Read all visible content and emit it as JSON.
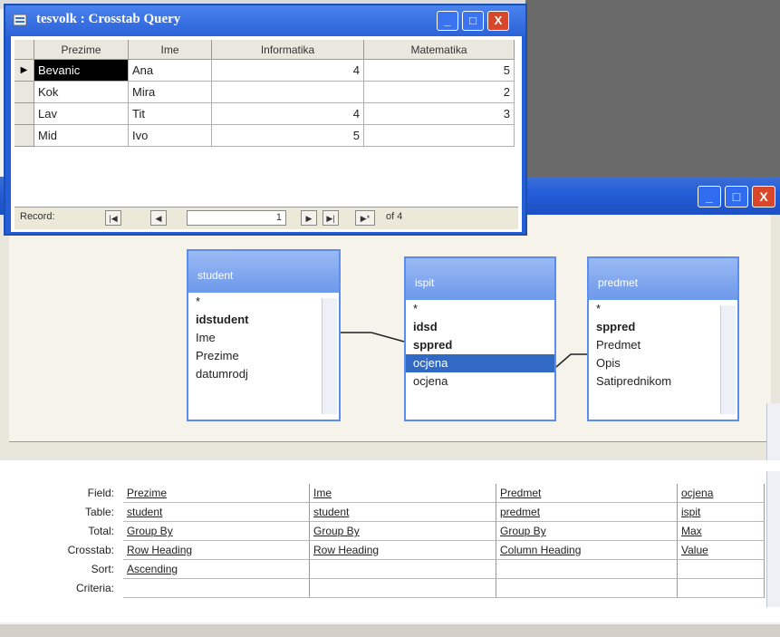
{
  "crosstab_window": {
    "title": "tesvolk : Crosstab Query",
    "icon": "query-icon",
    "controls": {
      "minimize": "_",
      "maximize": "□",
      "close": "X"
    },
    "columns": [
      "Prezime",
      "Ime",
      "Informatika",
      "Matematika"
    ],
    "rows": [
      {
        "selector": "▶",
        "prezime": "Bevanic",
        "ime": "Ana",
        "informatika": "4",
        "matematika": "5"
      },
      {
        "selector": "",
        "prezime": "Kok",
        "ime": "Mira",
        "informatika": "",
        "matematika": "2"
      },
      {
        "selector": "",
        "prezime": "Lav",
        "ime": "Tit",
        "informatika": "4",
        "matematika": "3"
      },
      {
        "selector": "",
        "prezime": "Mid",
        "ime": "Ivo",
        "informatika": "5",
        "matematika": ""
      }
    ],
    "navigation": {
      "label": "Record:",
      "first": "|◀",
      "prev": "◀",
      "current": "1",
      "next": "▶",
      "last": "▶|",
      "new": "▶*",
      "of": "of 4"
    }
  },
  "design_window": {
    "controls": {
      "minimize": "_",
      "maximize": "□",
      "close": "X"
    },
    "field_lists": [
      {
        "name": "student",
        "fields": [
          {
            "label": "*",
            "key": false,
            "selected": false
          },
          {
            "label": "idstudent",
            "key": true,
            "selected": false
          },
          {
            "label": "Ime",
            "key": false,
            "selected": false
          },
          {
            "label": "Prezime",
            "key": false,
            "selected": false
          },
          {
            "label": "datumrodj",
            "key": false,
            "selected": false
          }
        ]
      },
      {
        "name": "ispit",
        "fields": [
          {
            "label": "*",
            "key": false,
            "selected": false
          },
          {
            "label": "idsd",
            "key": true,
            "selected": false
          },
          {
            "label": "sppred",
            "key": true,
            "selected": false
          },
          {
            "label": "ocjena",
            "key": false,
            "selected": true
          },
          {
            "label": "ocjena",
            "key": false,
            "selected": false
          }
        ]
      },
      {
        "name": "predmet",
        "fields": [
          {
            "label": "*",
            "key": false,
            "selected": false
          },
          {
            "label": "sppred",
            "key": true,
            "selected": false
          },
          {
            "label": "Predmet",
            "key": false,
            "selected": false
          },
          {
            "label": "Opis",
            "key": false,
            "selected": false
          },
          {
            "label": "Satiprednikom",
            "key": false,
            "selected": false
          }
        ]
      }
    ],
    "qbe": {
      "row_labels": [
        "Field:",
        "Table:",
        "Total:",
        "Crosstab:",
        "Sort:",
        "Criteria:"
      ],
      "columns": [
        {
          "field": "Prezime",
          "table": "student",
          "total": "Group By",
          "crosstab": "Row Heading",
          "sort": "Ascending",
          "criteria": ""
        },
        {
          "field": "Ime",
          "table": "student",
          "total": "Group By",
          "crosstab": "Row Heading",
          "sort": "",
          "criteria": ""
        },
        {
          "field": "Predmet",
          "table": "predmet",
          "total": "Group By",
          "crosstab": "Column Heading",
          "sort": "",
          "criteria": ""
        },
        {
          "field": "ocjena",
          "table": "ispit",
          "total": "Max",
          "crosstab": "Value",
          "sort": "",
          "criteria": ""
        }
      ]
    }
  }
}
